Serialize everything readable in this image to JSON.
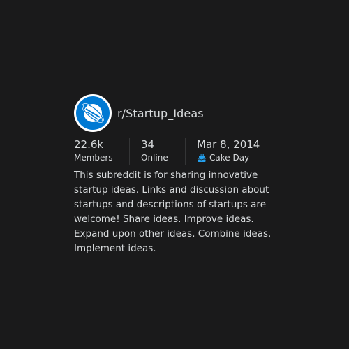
{
  "community": {
    "name": "r/Startup_Ideas",
    "avatar_icon": "planet-icon",
    "brand_color": "#0079d3"
  },
  "stats": {
    "members_value": "22.6k",
    "members_label": "Members",
    "online_value": "34",
    "online_label": "Online",
    "created_value": "Mar 8, 2014",
    "created_label": "Cake Day",
    "created_icon": "cake-icon"
  },
  "description": "This subreddit is for sharing innovative startup ideas. Links and discussion about startups and descriptions of startups are welcome! Share ideas. Improve ideas. Expand upon other ideas. Combine ideas. Implement ideas."
}
